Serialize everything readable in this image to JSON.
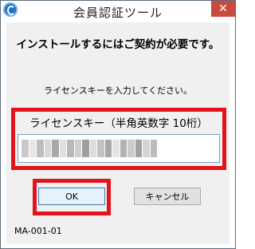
{
  "window": {
    "title": "会員認証ツール",
    "close_label": "✕",
    "icon": "app-logo-icon"
  },
  "dialog": {
    "headline": "インストールするにはご契約が必要です。",
    "instruction": "ライセンスキーを入力してください。",
    "key_label": "ライセンスキー（半角英数字 10桁）",
    "key_input_value": "",
    "ok_label": "OK",
    "cancel_label": "キャンセル",
    "code": "MA-001-01"
  },
  "colors": {
    "highlight": "#e2141b",
    "close_button": "#c74b3f",
    "input_border": "#7a9cc6"
  }
}
